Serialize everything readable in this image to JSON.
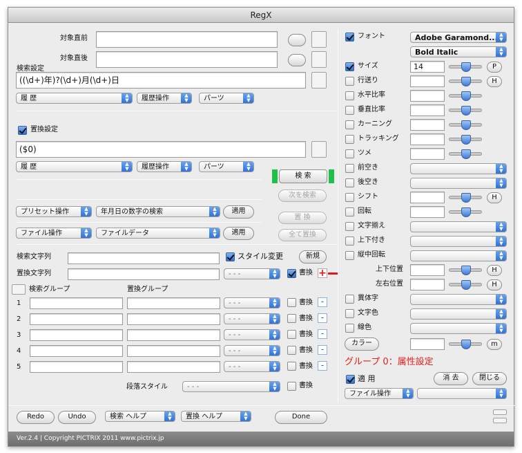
{
  "window": {
    "title": "RegX"
  },
  "search": {
    "before_label": "対象直前",
    "after_label": "対象直後",
    "settings_label": "検索設定",
    "pattern_value": "((\\d+)年)?(\\d+)月(\\d+)日",
    "history_label": "履 歴",
    "history_op_label": "履歴操作",
    "parts_label": "パーツ"
  },
  "replace": {
    "settings_label": "置換設定",
    "pattern_value": "($0)",
    "history_label": "履 歴",
    "history_op_label": "履歴操作",
    "parts_label": "パーツ"
  },
  "actions": {
    "search": "検 索",
    "find_next": "次を検索",
    "replace": "置 換",
    "replace_all": "全て置換"
  },
  "preset": {
    "op_label": "プリセット操作",
    "selected": "年月日の数字の検索",
    "apply": "適用"
  },
  "file": {
    "op_label": "ファイル操作",
    "selected": "ファイルデータ",
    "apply": "適用"
  },
  "strings": {
    "search_label": "検索文字列",
    "replace_label": "置換文字列",
    "style_change_label": "スタイル変更",
    "new_button": "新規",
    "replace_style": "- - -",
    "write_label": "書換"
  },
  "groups": {
    "search_header": "検索グループ",
    "replace_header": "置換グループ",
    "rows": [
      {
        "num": "1",
        "style": "- - -",
        "write": "書換"
      },
      {
        "num": "2",
        "style": "- - -",
        "write": "書換"
      },
      {
        "num": "3",
        "style": "- - -",
        "write": "書換"
      },
      {
        "num": "4",
        "style": "- - -",
        "write": "書換"
      },
      {
        "num": "5",
        "style": "- - -",
        "write": "書換"
      }
    ],
    "paragraph_style_label": "段落スタイル",
    "paragraph_style_value": "- - -",
    "paragraph_write": "書換"
  },
  "bottom": {
    "redo": "Redo",
    "undo": "Undo",
    "search_help": "検索 ヘルプ",
    "replace_help": "置換 ヘルプ",
    "done": "Done"
  },
  "attributes": {
    "font_label": "フォント",
    "font_value": "Adobe Garamond...",
    "style_value": "Bold Italic",
    "size_label": "サイズ",
    "size_value": "14",
    "p_button": "P",
    "h_button": "H",
    "m_button": "m",
    "leading_label": "行送り",
    "hscale_label": "水平比率",
    "vscale_label": "垂直比率",
    "kerning_label": "カーニング",
    "tracking_label": "トラッキング",
    "tsume_label": "ツメ",
    "space_before_label": "前空き",
    "space_after_label": "後空き",
    "shift_label": "シフト",
    "rotate_label": "回転",
    "align_label": "文字揃え",
    "tcy_label": "上下付き",
    "vertical_rotate_label": "縦中回転",
    "vpos_label": "上下位置",
    "hpos_label": "左右位置",
    "variant_label": "異体字",
    "color_label": "文字色",
    "line_color_label": "線色",
    "color_button": "カラー",
    "group_status": "グループ 0：属性設定",
    "apply_label": "適 用",
    "clear_button": "消 去",
    "close_button": "閉じる",
    "file_op_label": "ファイル操作"
  },
  "status_bar": {
    "text": "Ver.2.4 | Copyright PICTRIX 2011 www.pictrix.jp"
  }
}
